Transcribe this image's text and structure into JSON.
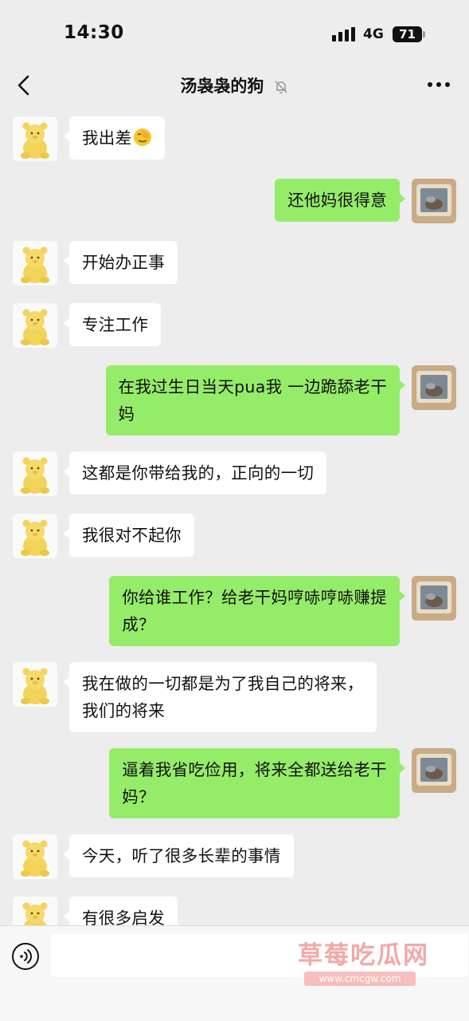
{
  "status_bar": {
    "time": "14:30",
    "network": "4G",
    "battery": "71"
  },
  "header": {
    "title": "汤袅袅的狗",
    "mute_icon": "bell-slash-icon",
    "more_icon": "ellipsis-icon",
    "back_icon": "chevron-left-icon"
  },
  "messages": [
    {
      "side": "left",
      "text": "我出差",
      "emoji": "facepalm-emoji"
    },
    {
      "side": "right",
      "text": "还他妈很得意"
    },
    {
      "side": "left",
      "text": "开始办正事"
    },
    {
      "side": "left",
      "text": "专注工作"
    },
    {
      "side": "right",
      "line1": "在我过生日当天pua我 一边跪舔老干",
      "line2": "妈"
    },
    {
      "side": "left",
      "text": "这都是你带给我的，正向的一切"
    },
    {
      "side": "left",
      "text": "我很对不起你"
    },
    {
      "side": "right",
      "line1": "你给谁工作？给老干妈哼哧哼哧赚提",
      "line2": "成？"
    },
    {
      "side": "left",
      "line1": "我在做的一切都是为了我自己的将来，",
      "line2": "我们的将来"
    },
    {
      "side": "right",
      "line1": "逼着我省吃俭用，将来全都送给老干",
      "line2": "妈？"
    },
    {
      "side": "left",
      "text": "今天，听了很多长辈的事情"
    },
    {
      "side": "left",
      "text": "有很多启发"
    }
  ],
  "input_bar": {
    "voice_icon": "voice-wave-icon",
    "placeholder": ""
  },
  "watermark": {
    "title": "草莓吃瓜网",
    "url": "www.cmcgw.com"
  },
  "colors": {
    "background": "#ededed",
    "sent_bubble": "#95ec69",
    "received_bubble": "#ffffff"
  }
}
